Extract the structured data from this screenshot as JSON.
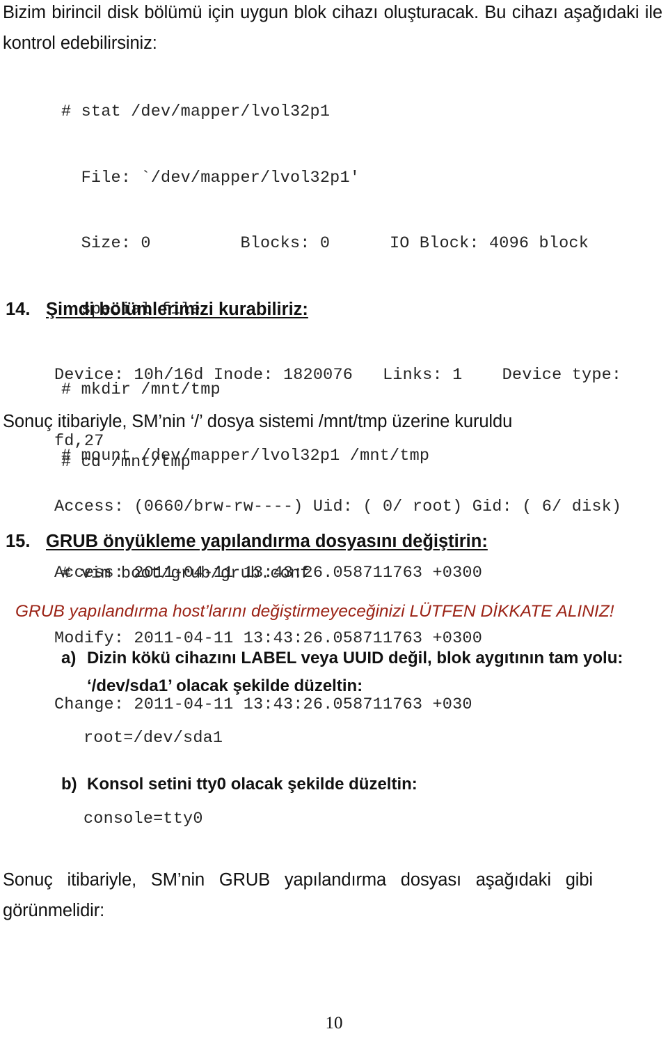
{
  "document": {
    "language": "tr",
    "page_number": "10",
    "colors": {
      "text": "#111111",
      "code": "#252525",
      "notice_red": "#9B2316",
      "background": "#ffffff"
    }
  },
  "intro": {
    "paragraph": "Bizim birincil disk bölümü için uygun blok cihazı oluşturacak. Bu cihazı aşağıdaki ile kontrol edebilirsiniz:"
  },
  "stat_output": {
    "lines": [
      "# stat /dev/mapper/lvol32p1",
      "  File: `/dev/mapper/lvol32p1'",
      "  Size: 0         Blocks: 0      IO Block: 4096 block",
      "  special file",
      "Device: 10h/16d Inode: 1820076   Links: 1    Device type:",
      "fd,27",
      "Access: (0660/brw-rw----) Uid: ( 0/ root) Gid: ( 6/ disk)",
      "Access: 2011-04-11 13:43:26.058711763 +0300",
      "Modify: 2011-04-11 13:43:26.058711763 +0300",
      "Change: 2011-04-11 13:43:26.058711763 +030"
    ]
  },
  "step14": {
    "number": "14.",
    "heading": "Şimdi bölümlerimizi kurabiliriz:",
    "commands": [
      "# mkdir /mnt/tmp",
      "# mount /dev/mapper/lvol32p1 /mnt/tmp"
    ],
    "result_text": "Sonuç itibariyle, SM’nin ‘/’ dosya sistemi /mnt/tmp üzerine kuruldu",
    "cd_command": "# cd /mnt/tmp"
  },
  "step15": {
    "number": "15.",
    "heading": "GRUB önyükleme yapılandırma dosyasını değiştirin:",
    "vim_command": "# vim boot/grub/grub.conf",
    "notice": "GRUB yapılandırma host’larını değiştirmeyeceğinizi LÜTFEN DİKKATE ALINIZ!",
    "items": [
      {
        "letter": "a)",
        "text_line1": "Dizin kökü cihazını LABEL veya UUID değil, blok aygıtının tam yolu:",
        "text_line2": "‘/dev/sda1’ olacak şekilde düzeltin:",
        "code": "root=/dev/sda1"
      },
      {
        "letter": "b)",
        "text_line1": "Konsol setini tty0 olacak şekilde düzeltin:",
        "text_line2": "",
        "code": "console=tty0"
      }
    ],
    "closing_text": "Sonuç itibariyle, SM’nin GRUB yapılandırma dosyası aşağıdaki gibi görünmelidir:"
  }
}
